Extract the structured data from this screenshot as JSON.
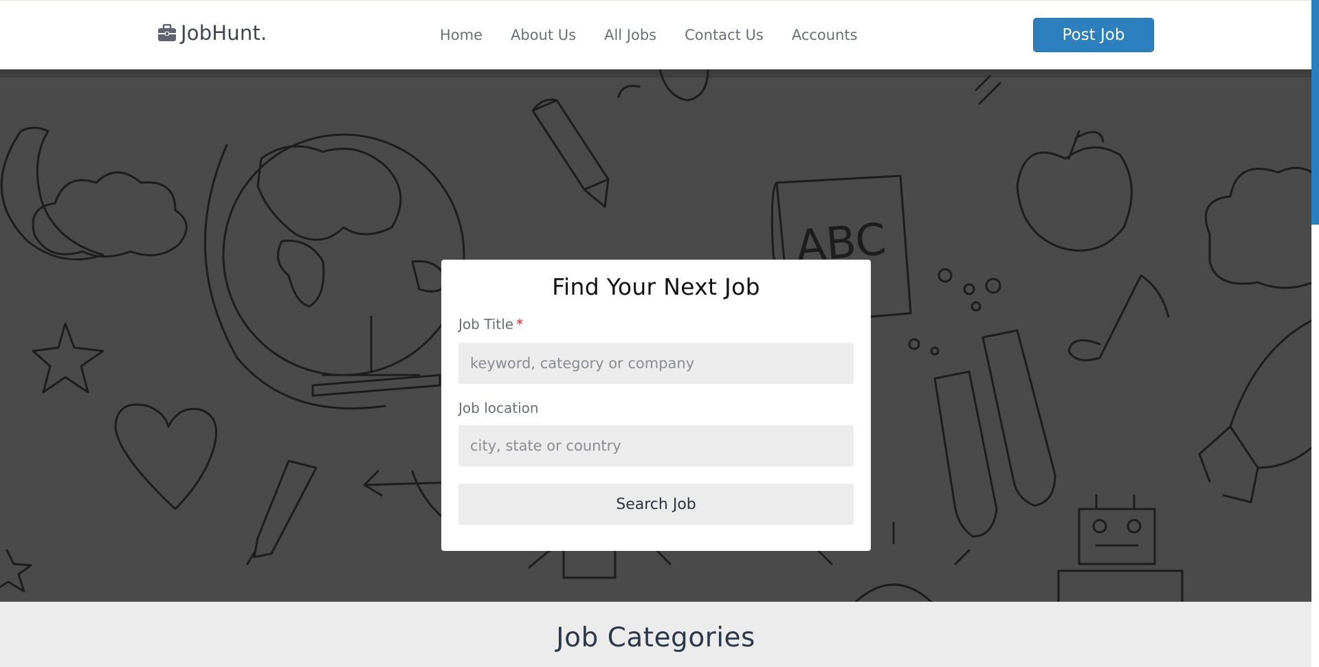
{
  "brand": {
    "name": "JobHunt.",
    "icon": "briefcase-icon"
  },
  "nav": {
    "links": [
      "Home",
      "About Us",
      "All Jobs",
      "Contact Us",
      "Accounts"
    ],
    "post_job_label": "Post Job"
  },
  "hero": {
    "doodle_letters": "ABC"
  },
  "search": {
    "title": "Find Your Next Job",
    "job_title_label": "Job Title",
    "required_mark": "*",
    "job_title_placeholder": "keyword, category or company",
    "job_title_value": "",
    "location_label": "Job location",
    "location_placeholder": "city, state or country",
    "location_value": "",
    "button_label": "Search Job"
  },
  "categories": {
    "title": "Job Categories"
  },
  "colors": {
    "accent": "#2b80bd",
    "hero_overlay": "#4a4a4b",
    "required": "#e02020",
    "section_bg": "#ececec"
  }
}
